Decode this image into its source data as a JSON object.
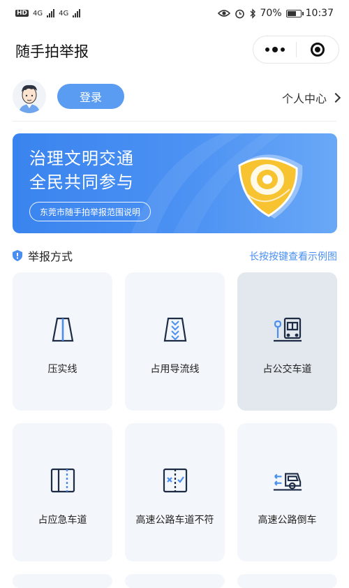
{
  "status": {
    "hd": "HD",
    "net1": "4G",
    "net2": "4G",
    "battery_pct": "70%",
    "battery_level": 0.7,
    "time": "10:37"
  },
  "titlebar": {
    "title": "随手拍举报",
    "menu_icon": "more-dots-icon",
    "close_icon": "target-close-icon"
  },
  "user": {
    "login_label": "登录",
    "center_label": "个人中心"
  },
  "banner": {
    "line1": "治理文明交通",
    "line2": "全民共同参与",
    "button_label": "东莞市随手拍举报范围说明",
    "colors": {
      "start": "#3a84ef",
      "end": "#6aa8f7",
      "shield": "#f7c331"
    }
  },
  "section": {
    "title": "举报方式",
    "hint": "长按按键查看示例图"
  },
  "categories": [
    {
      "label": "压实线",
      "icon": "solid-line-lane-icon"
    },
    {
      "label": "占用导流线",
      "icon": "diversion-line-icon"
    },
    {
      "label": "占公交车道",
      "icon": "bus-lane-icon"
    },
    {
      "label": "占应急车道",
      "icon": "emergency-lane-icon"
    },
    {
      "label": "高速公路车道不符",
      "icon": "wrong-lane-icon"
    },
    {
      "label": "高速公路倒车",
      "icon": "reversing-icon"
    }
  ],
  "accent_color": "#4a8ff0"
}
